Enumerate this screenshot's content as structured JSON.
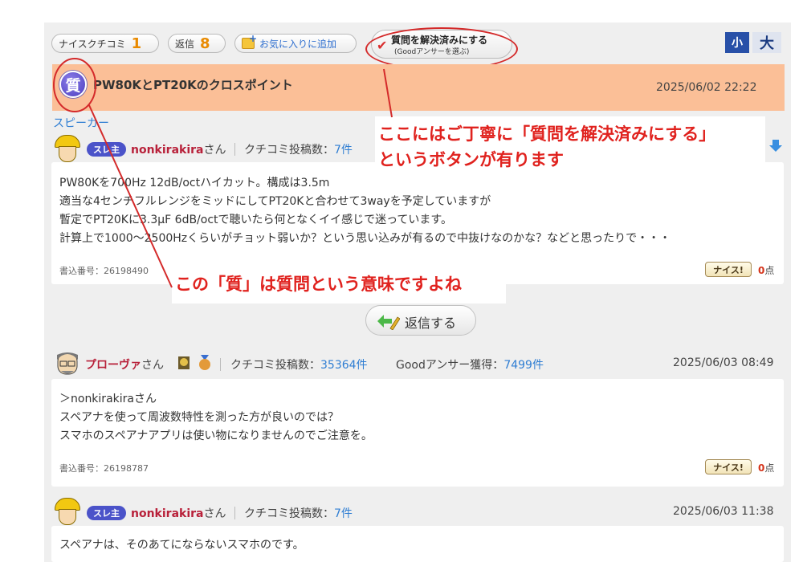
{
  "toolbar": {
    "nice_label": "ナイスクチコミ",
    "nice_count": "1",
    "reply_label": "返信",
    "reply_count": "8",
    "favorite_label": "お気に入りに追加",
    "solve_main": "質問を解決済みにする",
    "solve_sub": "(Goodアンサーを選ぶ)",
    "font_small": "小",
    "font_large": "大"
  },
  "question": {
    "badge": "質",
    "title": "PW80KとPT20Kのクロスポイント",
    "date": "2025/06/02 22:22",
    "category": "スピーカー"
  },
  "posts": [
    {
      "owner_tag": "スレ主",
      "username": "nonkirakira",
      "san": "さん",
      "posts_label": "クチコミ投稿数：",
      "posts_value": "7件",
      "lines": [
        "PW80Kを700Hz 12dB/octハイカット。構成は3.5m",
        "適当な4センチフルレンジをミッドにしてPT20Kと合わせて3wayを予定していますが",
        "暫定でPT20Kに3.3μF 6dB/octで聴いたら何となくイイ感じで迷っています。",
        "計算上で1000～2500Hzくらいがチョット弱いか？という思い込みが有るので中抜けなのかな？などと思ったりで・・・"
      ],
      "post_no": "書込番号：26198490",
      "nice_label": "ナイス!",
      "nice_count": "0",
      "nice_unit": "点"
    },
    {
      "username": "プローヴァ",
      "san": "さん",
      "posts_label": "クチコミ投稿数：",
      "posts_value": "35364件",
      "good_label": "Goodアンサー獲得：",
      "good_value": "7499件",
      "date": "2025/06/03 08:49",
      "lines": [
        "＞nonkirakiraさん",
        "スペアナを使って周波数特性を測った方が良いのでは？",
        "スマホのスペアナアプリは使い物になりませんのでご注意を。"
      ],
      "post_no": "書込番号：26198787",
      "nice_label": "ナイス!",
      "nice_count": "0",
      "nice_unit": "点"
    },
    {
      "owner_tag": "スレ主",
      "username": "nonkirakira",
      "san": "さん",
      "posts_label": "クチコミ投稿数：",
      "posts_value": "7件",
      "date": "2025/06/03 11:38",
      "lines": [
        "スペアナは、そのあてにならないスマホのです。"
      ]
    }
  ],
  "reply_button": "返信する",
  "annotations": {
    "top_line1": "ここにはご丁寧に「質問を解決済みにする」",
    "top_line2": "というボタンが有ります",
    "mid": "この「質」は質問という意味ですよね"
  },
  "colors": {
    "title_bar": "#fbbf97",
    "accent_red": "#e0221e",
    "link_blue": "#2f7ed3",
    "owner_tag": "#4b53c9"
  }
}
